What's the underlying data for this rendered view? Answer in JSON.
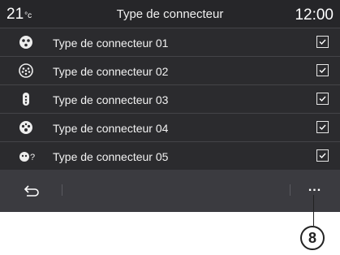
{
  "status_bar": {
    "temperature": "21",
    "temperature_unit": "°c",
    "title": "Type de connecteur",
    "clock": "12:00"
  },
  "connectors": [
    {
      "label": "Type de connecteur  01",
      "icon": "connector-type-01-icon",
      "checked": true
    },
    {
      "label": "Type de connecteur  02",
      "icon": "connector-type-02-icon",
      "checked": true
    },
    {
      "label": "Type de connecteur  03",
      "icon": "connector-type-03-icon",
      "checked": true
    },
    {
      "label": "Type de connecteur  04",
      "icon": "connector-type-04-icon",
      "checked": true
    },
    {
      "label": "Type de connecteur  05",
      "icon": "connector-unknown-icon",
      "checked": true
    }
  ],
  "bottom_bar": {
    "back_icon": "back-icon",
    "more_label": "..."
  },
  "callout": {
    "number": "8"
  }
}
